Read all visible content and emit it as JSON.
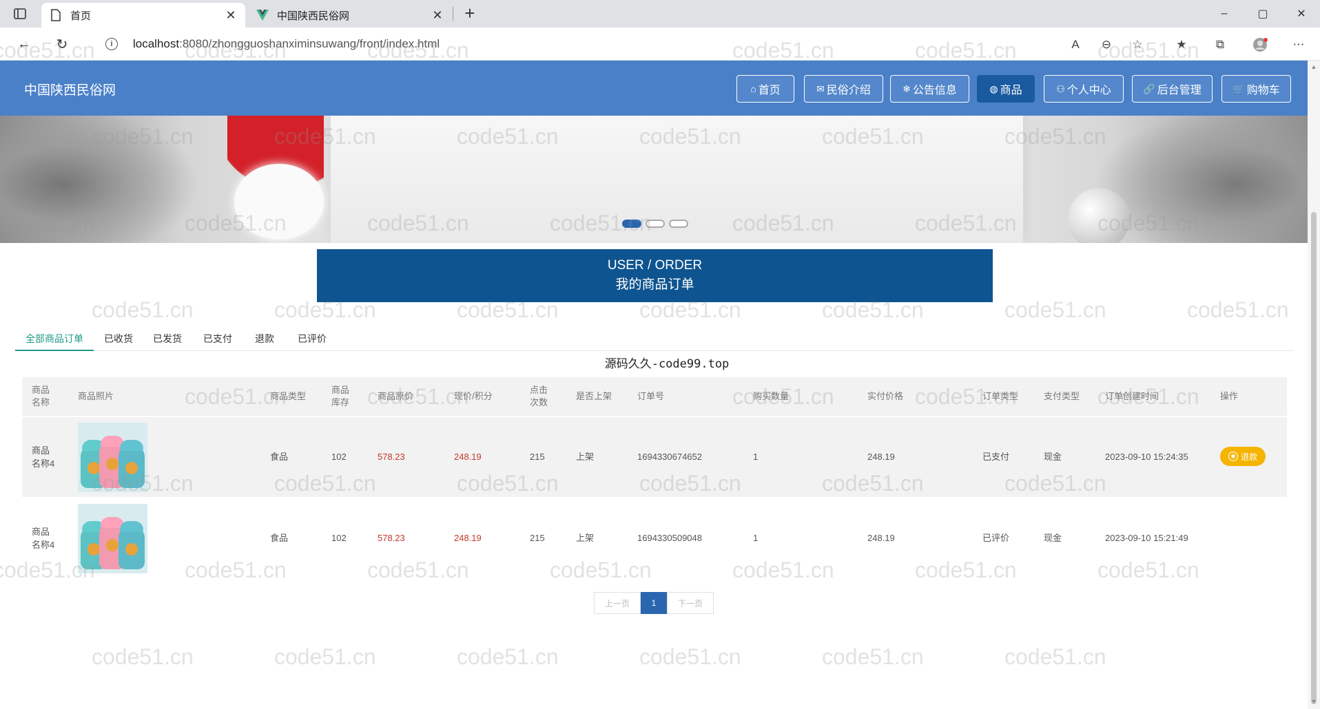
{
  "browser": {
    "tabs": [
      {
        "title": "首页",
        "active": true
      },
      {
        "title": "中国陕西民俗网",
        "active": false
      }
    ],
    "url_host": "localhost",
    "url_rest": ":8080/zhongguoshanximinsuwang/front/index.html",
    "window_controls": {
      "minimize": "–",
      "maximize": "▢",
      "close": "✕"
    }
  },
  "site": {
    "title": "中国陕西民俗网",
    "nav": [
      {
        "icon": "⌂",
        "label": "首页"
      },
      {
        "icon": "✉",
        "label": "民俗介绍"
      },
      {
        "icon": "❄",
        "label": "公告信息"
      },
      {
        "icon": "◍",
        "label": "商品"
      },
      {
        "icon": "⚇",
        "label": "个人中心"
      },
      {
        "icon": "🔗",
        "label": "后台管理"
      },
      {
        "icon": "🛒",
        "label": "购物车"
      }
    ],
    "active_nav": "商品"
  },
  "banner": {
    "slides": 3,
    "active_slide": 1
  },
  "section": {
    "title_en": "USER / ORDER",
    "title_cn": "我的商品订单"
  },
  "order_tabs": [
    "全部商品订单",
    "已收货",
    "已发货",
    "已支付",
    "退款",
    "已评价"
  ],
  "active_order_tab": "全部商品订单",
  "source_label": "源码久久-code99.top",
  "table": {
    "headers": [
      "商品名称",
      "商品照片",
      "商品类型",
      "商品库存",
      "商品原价",
      "现价/积分",
      "点击次数",
      "是否上架",
      "订单号",
      "购买数量",
      "实付价格",
      "订单类型",
      "支付类型",
      "订单创建时间",
      "操作"
    ],
    "rows": [
      {
        "name": "商品名称4",
        "type": "食品",
        "stock": "102",
        "orig_price": "578.23",
        "price": "248.19",
        "clicks": "215",
        "on_shelf": "上架",
        "order_no": "1694330674652",
        "qty": "1",
        "paid": "248.19",
        "order_type": "已支付",
        "pay_type": "现金",
        "created": "2023-09-10 15:24:35",
        "action": "退款"
      },
      {
        "name": "商品名称4",
        "type": "食品",
        "stock": "102",
        "orig_price": "578.23",
        "price": "248.19",
        "clicks": "215",
        "on_shelf": "上架",
        "order_no": "1694330509048",
        "qty": "1",
        "paid": "248.19",
        "order_type": "已评价",
        "pay_type": "现金",
        "created": "2023-09-10 15:21:49",
        "action": ""
      }
    ]
  },
  "pagination": {
    "prev": "上一页",
    "current": "1",
    "next": "下一页"
  },
  "watermark": "code51.cn",
  "colors": {
    "header": "#4a80c8",
    "active_nav": "#1a5aa0",
    "section": "#0e5490",
    "accent_tab": "#1f9a8a",
    "price": "#c0392b",
    "refund": "#f4b400"
  }
}
